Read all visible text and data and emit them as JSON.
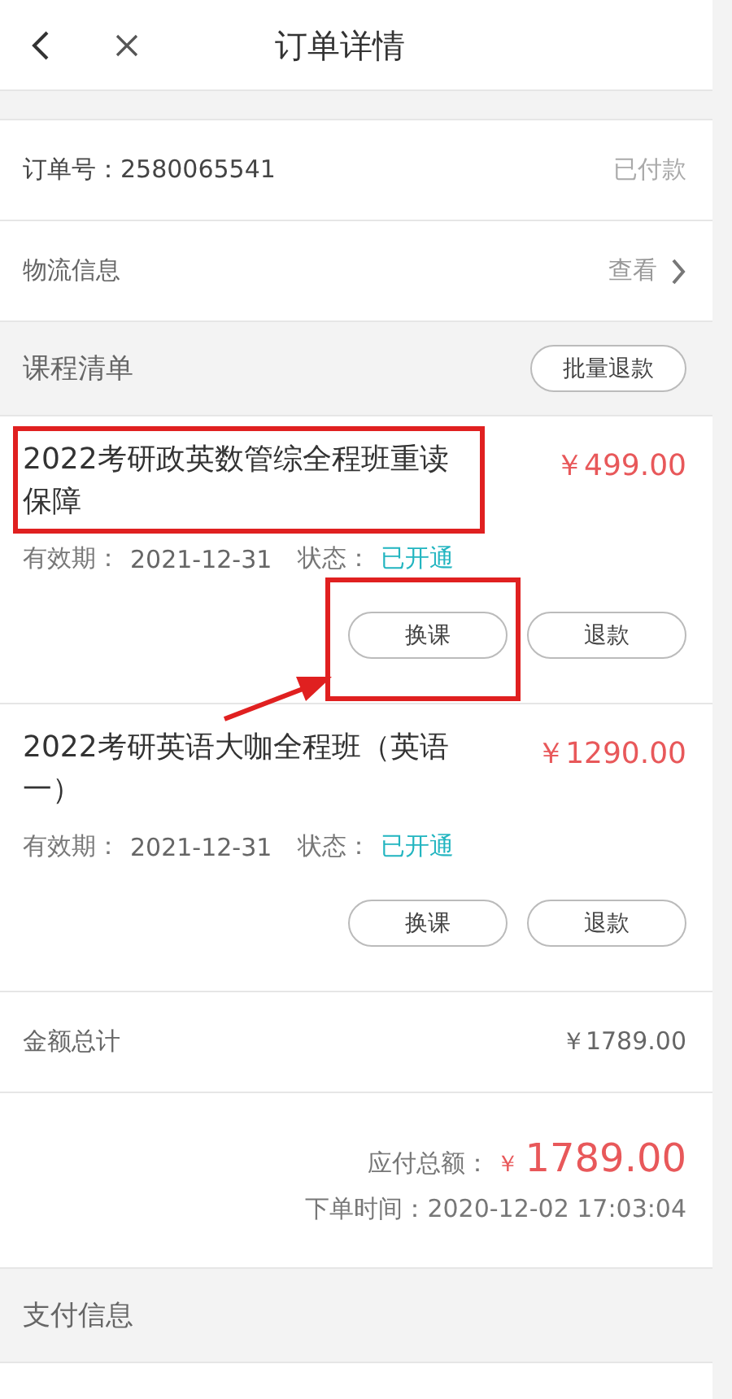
{
  "header": {
    "title": "订单详情"
  },
  "order": {
    "number_label": "订单号：2580065541",
    "status": "已付款"
  },
  "logistics": {
    "label": "物流信息",
    "action": "查看"
  },
  "course_list": {
    "title": "课程清单",
    "batch_button": "批量退款"
  },
  "courses": [
    {
      "name": "2022考研政英数管综全程班重读保障",
      "price": "￥499.00",
      "validity_label": "有效期：",
      "validity": "2021-12-31",
      "status_label": "状态：",
      "status": "已开通",
      "swap_button": "换课",
      "refund_button": "退款",
      "name_framed": true,
      "swap_button_framed": true
    },
    {
      "name": "2022考研英语大咖全程班（英语一）",
      "price": "￥1290.00",
      "validity_label": "有效期：",
      "validity": "2021-12-31",
      "status_label": "状态：",
      "status": "已开通",
      "swap_button": "换课",
      "refund_button": "退款",
      "name_framed": false,
      "swap_button_framed": false
    }
  ],
  "annotation_arrow": true,
  "total": {
    "label": "金额总计",
    "value": "￥1789.00"
  },
  "payable": {
    "label": "应付总额：",
    "currency": "￥",
    "amount": "1789.00",
    "order_time": "下单时间：2020-12-02 17:03:04"
  },
  "payment": {
    "title": "支付信息"
  }
}
